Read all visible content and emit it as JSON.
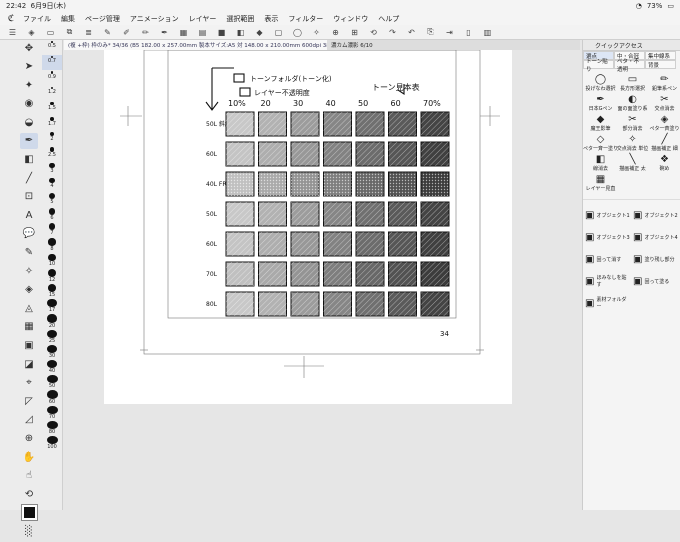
{
  "status": {
    "time": "22:42",
    "date": "6月9日(木)",
    "battery": "73%"
  },
  "menu": [
    "ファイル",
    "編集",
    "ページ管理",
    "アニメーション",
    "レイヤー",
    "選択範囲",
    "表示",
    "フィルター",
    "ウィンドウ",
    "ヘルプ"
  ],
  "tabs": [
    {
      "label": "(複 +枠) 枠のみ* 34/36 (B5 182.00 x 257.00mm 製本サイズ:A5 対 148.00 x 210.00mm 600dpi 38.2%)"
    },
    {
      "label": "濃カム濃影 6/10"
    }
  ],
  "brush_sizes": [
    "0.5",
    "0.7",
    "0.9",
    "1.2",
    "1.5",
    "1.7",
    "2",
    "2.5",
    "3",
    "4",
    "5",
    "6",
    "7",
    "8",
    "10",
    "12",
    "15",
    "17",
    "20",
    "25",
    "30",
    "40",
    "50",
    "60",
    "70",
    "80",
    "100"
  ],
  "panel": {
    "title": "クイックアクセス",
    "tabs": [
      "選点",
      "中・合冠",
      "集中線系",
      "トーン貼り",
      "ペタ・不透明",
      "背景"
    ],
    "items": [
      "投げなわ選択",
      "長方形選択",
      "鉛筆系ペン",
      "日本Gペン",
      "面の面塗り系",
      "交点消去",
      "魔王影筆",
      "部分消去",
      "ペタ一斉塗り",
      "ペタ一斉一塗り",
      "交点消去 単位",
      "描画補正 細",
      "線消去",
      "描画補正 太",
      "碗め",
      "レイヤー見直"
    ],
    "items2": [
      "オブジェクト1",
      "オブジェクト2",
      "オブジェクト3",
      "オブジェクト4",
      "固って消す",
      "塗り残し部分",
      "ほみなしを貼す",
      "固って塗る",
      "素材フォルダー"
    ]
  },
  "canvas": {
    "legend1": "トーンフォルダ(トーン化)",
    "legend2": "レイヤー不透明度",
    "chart_title": "トーン見本表",
    "cols": [
      "10%",
      "20",
      "30",
      "40",
      "50",
      "60",
      "70%"
    ],
    "rows": [
      "50L 斜線",
      "60L",
      "40L FREY",
      "50L",
      "60L",
      "70L",
      "80L"
    ],
    "page_num": "34"
  }
}
